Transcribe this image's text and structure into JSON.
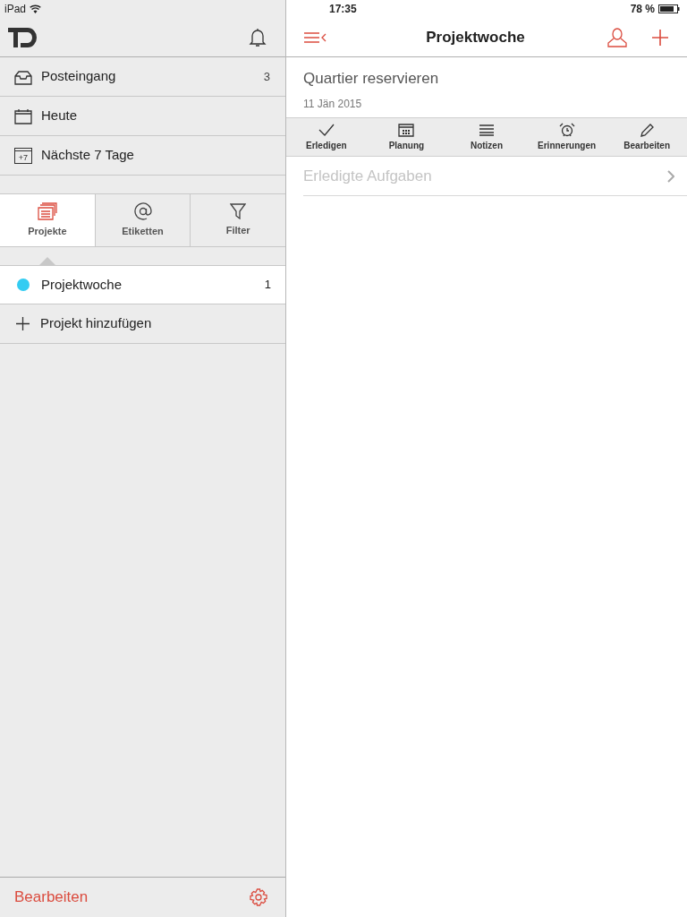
{
  "status_bar": {
    "device": "iPad",
    "time": "17:35",
    "battery": "78 %"
  },
  "sidebar": {
    "nav": [
      {
        "kind": "inbox",
        "label": "Posteingang",
        "count": "3"
      },
      {
        "kind": "today",
        "label": "Heute"
      },
      {
        "kind": "week",
        "label": "Nächste 7 Tage",
        "icon_text": "+7"
      }
    ],
    "tabs": [
      {
        "kind": "projects",
        "label": "Projekte",
        "selected": true
      },
      {
        "kind": "labels",
        "label": "Etiketten",
        "selected": false
      },
      {
        "kind": "filter",
        "label": "Filter",
        "selected": false
      }
    ],
    "projects": [
      {
        "label": "Projektwoche",
        "count": "1",
        "color": "#33ccf2",
        "selected": true
      }
    ],
    "add_project": "Projekt hinzufügen",
    "footer": {
      "edit": "Bearbeiten"
    }
  },
  "main": {
    "title": "Projektwoche",
    "task": {
      "title": "Quartier reservieren",
      "date": "11 Jän 2015"
    },
    "actions": [
      {
        "kind": "complete",
        "label": "Erledigen"
      },
      {
        "kind": "schedule",
        "label": "Planung"
      },
      {
        "kind": "notes",
        "label": "Notizen"
      },
      {
        "kind": "reminders",
        "label": "Erinnerungen"
      },
      {
        "kind": "edit",
        "label": "Bearbeiten"
      }
    ],
    "completed": "Erledigte Aufgaben"
  }
}
